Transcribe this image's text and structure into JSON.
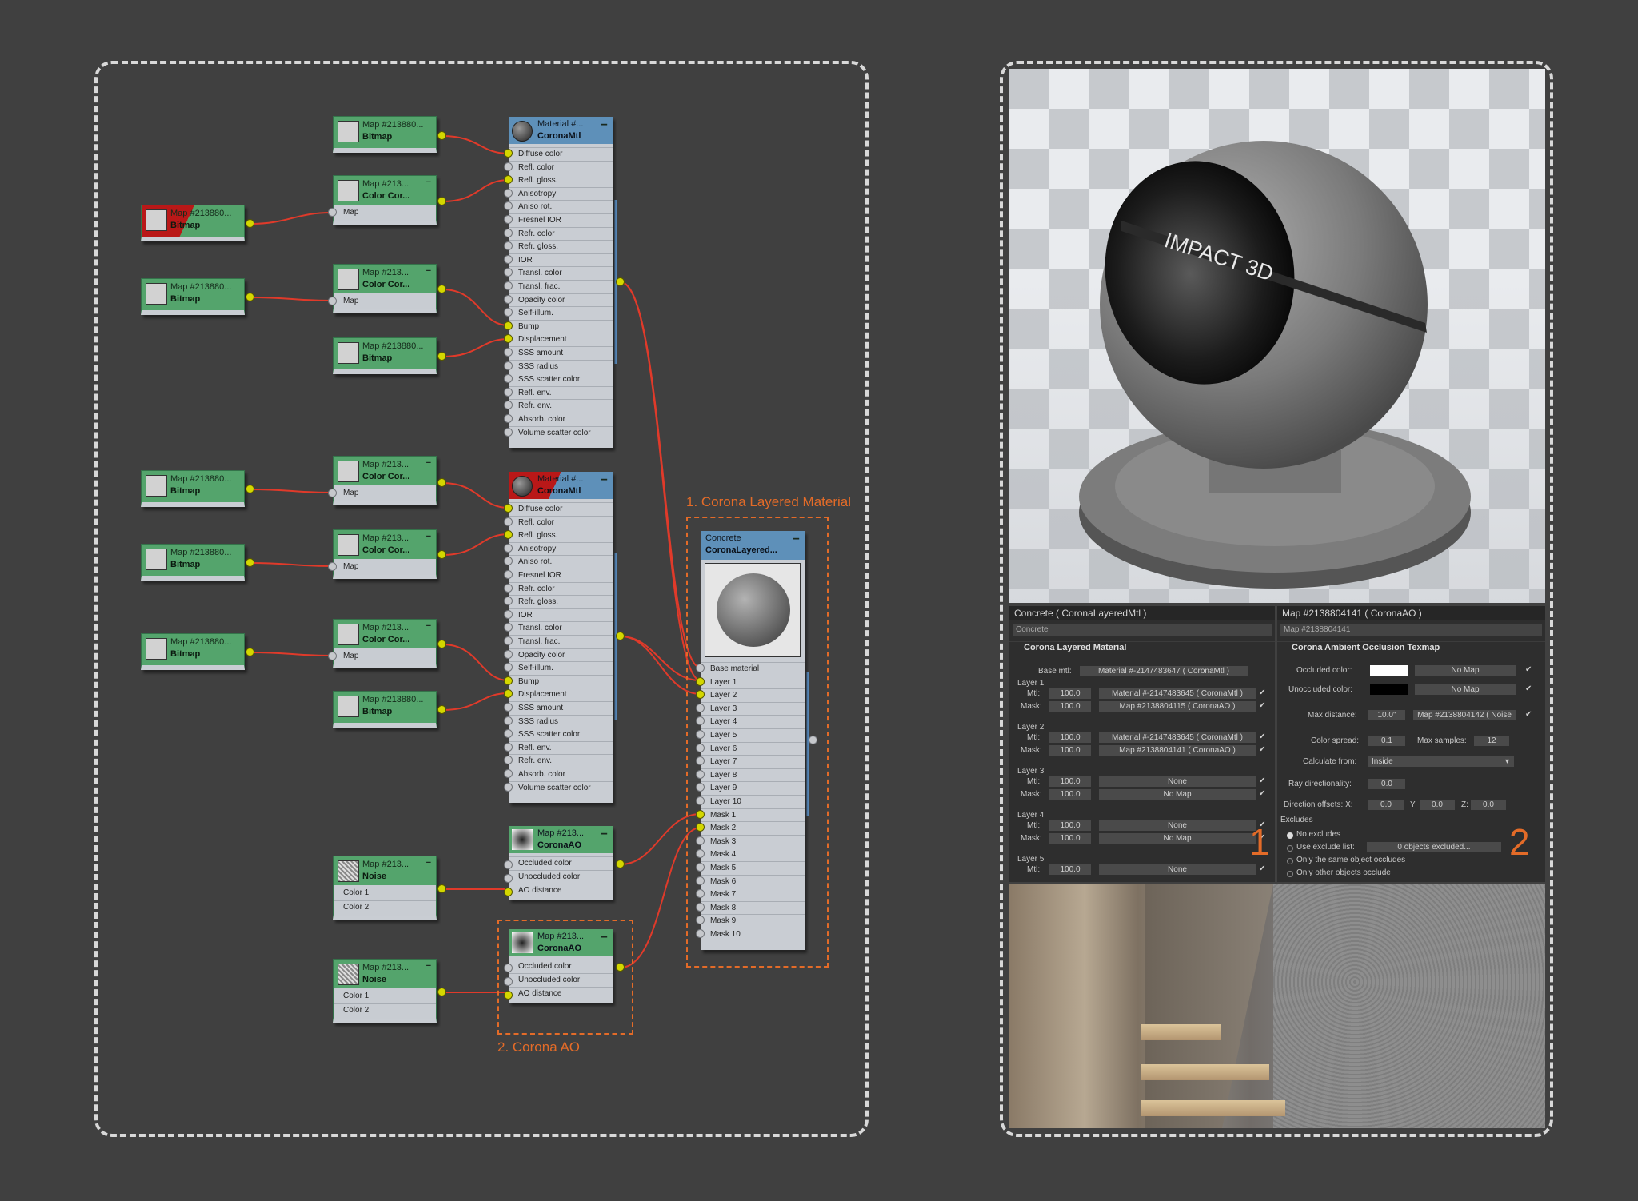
{
  "editor": {
    "left_maps": [
      {
        "name": "Map #213880...",
        "type": "Bitmap"
      },
      {
        "name": "Map #213880...",
        "type": "Bitmap"
      },
      {
        "name": "Map #213880...",
        "type": "Bitmap"
      },
      {
        "name": "Map #213880...",
        "type": "Bitmap"
      },
      {
        "name": "Map #213880...",
        "type": "Bitmap"
      }
    ],
    "mid_maps": [
      {
        "name": "Map #213880...",
        "type": "Bitmap"
      },
      {
        "name": "Map #213...",
        "type": "Color Cor...",
        "sub": "Map"
      },
      {
        "name": "Map #213...",
        "type": "Color Cor...",
        "sub": "Map"
      },
      {
        "name": "Map #213880...",
        "type": "Bitmap"
      },
      {
        "name": "Map #213...",
        "type": "Color Cor...",
        "sub": "Map"
      },
      {
        "name": "Map #213...",
        "type": "Color Cor...",
        "sub": "Map"
      },
      {
        "name": "Map #213...",
        "type": "Color Cor...",
        "sub": "Map"
      },
      {
        "name": "Map #213880...",
        "type": "Bitmap"
      }
    ],
    "noise_maps": [
      {
        "name": "Map #213...",
        "type": "Noise",
        "rows": [
          "Color 1",
          "Color 2"
        ]
      },
      {
        "name": "Map #213...",
        "type": "Noise",
        "rows": [
          "Color 1",
          "Color 2"
        ]
      }
    ],
    "materials": [
      {
        "name": "Material #...",
        "type": "CoronaMtl"
      },
      {
        "name": "Material #...",
        "type": "CoronaMtl"
      }
    ],
    "mat_slots": [
      "Diffuse color",
      "Refl. color",
      "Refl. gloss.",
      "Anisotropy",
      "Aniso rot.",
      "Fresnel IOR",
      "Refr. color",
      "Refr. gloss.",
      "IOR",
      "Transl. color",
      "Transl. frac.",
      "Opacity color",
      "Self-illum.",
      "Bump",
      "Displacement",
      "SSS amount",
      "SSS radius",
      "SSS scatter color",
      "Refl. env.",
      "Refr. env.",
      "Absorb. color",
      "Volume scatter color"
    ],
    "ao_nodes": [
      {
        "name": "Map #213...",
        "type": "CoronaAO",
        "rows": [
          "Occluded color",
          "Unoccluded color",
          "AO distance"
        ]
      },
      {
        "name": "Map #213...",
        "type": "CoronaAO",
        "rows": [
          "Occluded color",
          "Unoccluded color",
          "AO distance"
        ]
      }
    ],
    "layered": {
      "name": "Concrete",
      "type": "CoronaLayered...",
      "slots": [
        "Base material",
        "Layer 1",
        "Layer 2",
        "Layer 3",
        "Layer 4",
        "Layer 5",
        "Layer 6",
        "Layer 7",
        "Layer 8",
        "Layer 9",
        "Layer 10",
        "Mask 1",
        "Mask 2",
        "Mask 3",
        "Mask 4",
        "Mask 5",
        "Mask 6",
        "Mask 7",
        "Mask 8",
        "Mask 9",
        "Mask 10"
      ]
    },
    "annotations": {
      "layered": "1. Corona Layered Material",
      "ao": "2. Corona AO"
    }
  },
  "viewport": {
    "logo_text": "IMPACT 3D"
  },
  "panel_layered": {
    "title": "Concrete  ( CoronaLayeredMtl )",
    "name": "Concrete",
    "section": "Corona Layered Material",
    "base_label": "Base mtl:",
    "base_value": "Material #-2147483647  ( CoronaMtl )",
    "layers": [
      {
        "label": "Layer 1",
        "mtl_amt": "100.0",
        "mtl": "Material #-2147483645  ( CoronaMtl )",
        "mask_amt": "100.0",
        "mask": "Map #2138804115  ( CoronaAO )"
      },
      {
        "label": "Layer 2",
        "mtl_amt": "100.0",
        "mtl": "Material #-2147483645  ( CoronaMtl )",
        "mask_amt": "100.0",
        "mask": "Map #2138804141  ( CoronaAO )"
      },
      {
        "label": "Layer 3",
        "mtl_amt": "100.0",
        "mtl": "None",
        "mask_amt": "100.0",
        "mask": "No Map"
      },
      {
        "label": "Layer 4",
        "mtl_amt": "100.0",
        "mtl": "None",
        "mask_amt": "100.0",
        "mask": "No Map"
      },
      {
        "label": "Layer 5",
        "mtl_amt": "100.0",
        "mtl": "None"
      }
    ],
    "mtl_label": "Mtl:",
    "mask_label": "Mask:",
    "marker": "1"
  },
  "panel_ao": {
    "title": "Map #2138804141  ( CoronaAO )",
    "name": "Map #2138804141",
    "section": "Corona Ambient Occlusion Texmap",
    "occluded_label": "Occluded color:",
    "unoccluded_label": "Unoccluded color:",
    "no_map": "No Map",
    "max_distance_label": "Max distance:",
    "max_distance": "10.0\"",
    "max_distance_map": "Map #2138804142  ( Noise",
    "color_spread_label": "Color spread:",
    "color_spread": "0.1",
    "max_samples_label": "Max samples:",
    "max_samples": "12",
    "calc_label": "Calculate from:",
    "calc_value": "Inside",
    "ray_label": "Ray directionality:",
    "ray_value": "0.0",
    "dir_label": "Direction offsets: X:",
    "dir_x": "0.0",
    "dir_y_label": "Y:",
    "dir_y": "0.0",
    "dir_z_label": "Z:",
    "dir_z": "0.0",
    "excludes_label": "Excludes",
    "no_excludes": "No excludes",
    "use_list": "Use exclude list:",
    "objects_excluded": "0 objects excluded...",
    "same_object": "Only the same object occludes",
    "other_objects": "Only other objects occlude",
    "marker": "2"
  },
  "colors": {
    "wire": "#e03a2a",
    "annotation": "#e36b28",
    "port": "#d4d700",
    "map_node": "#54a46c",
    "material_header": "#5e90b9"
  }
}
